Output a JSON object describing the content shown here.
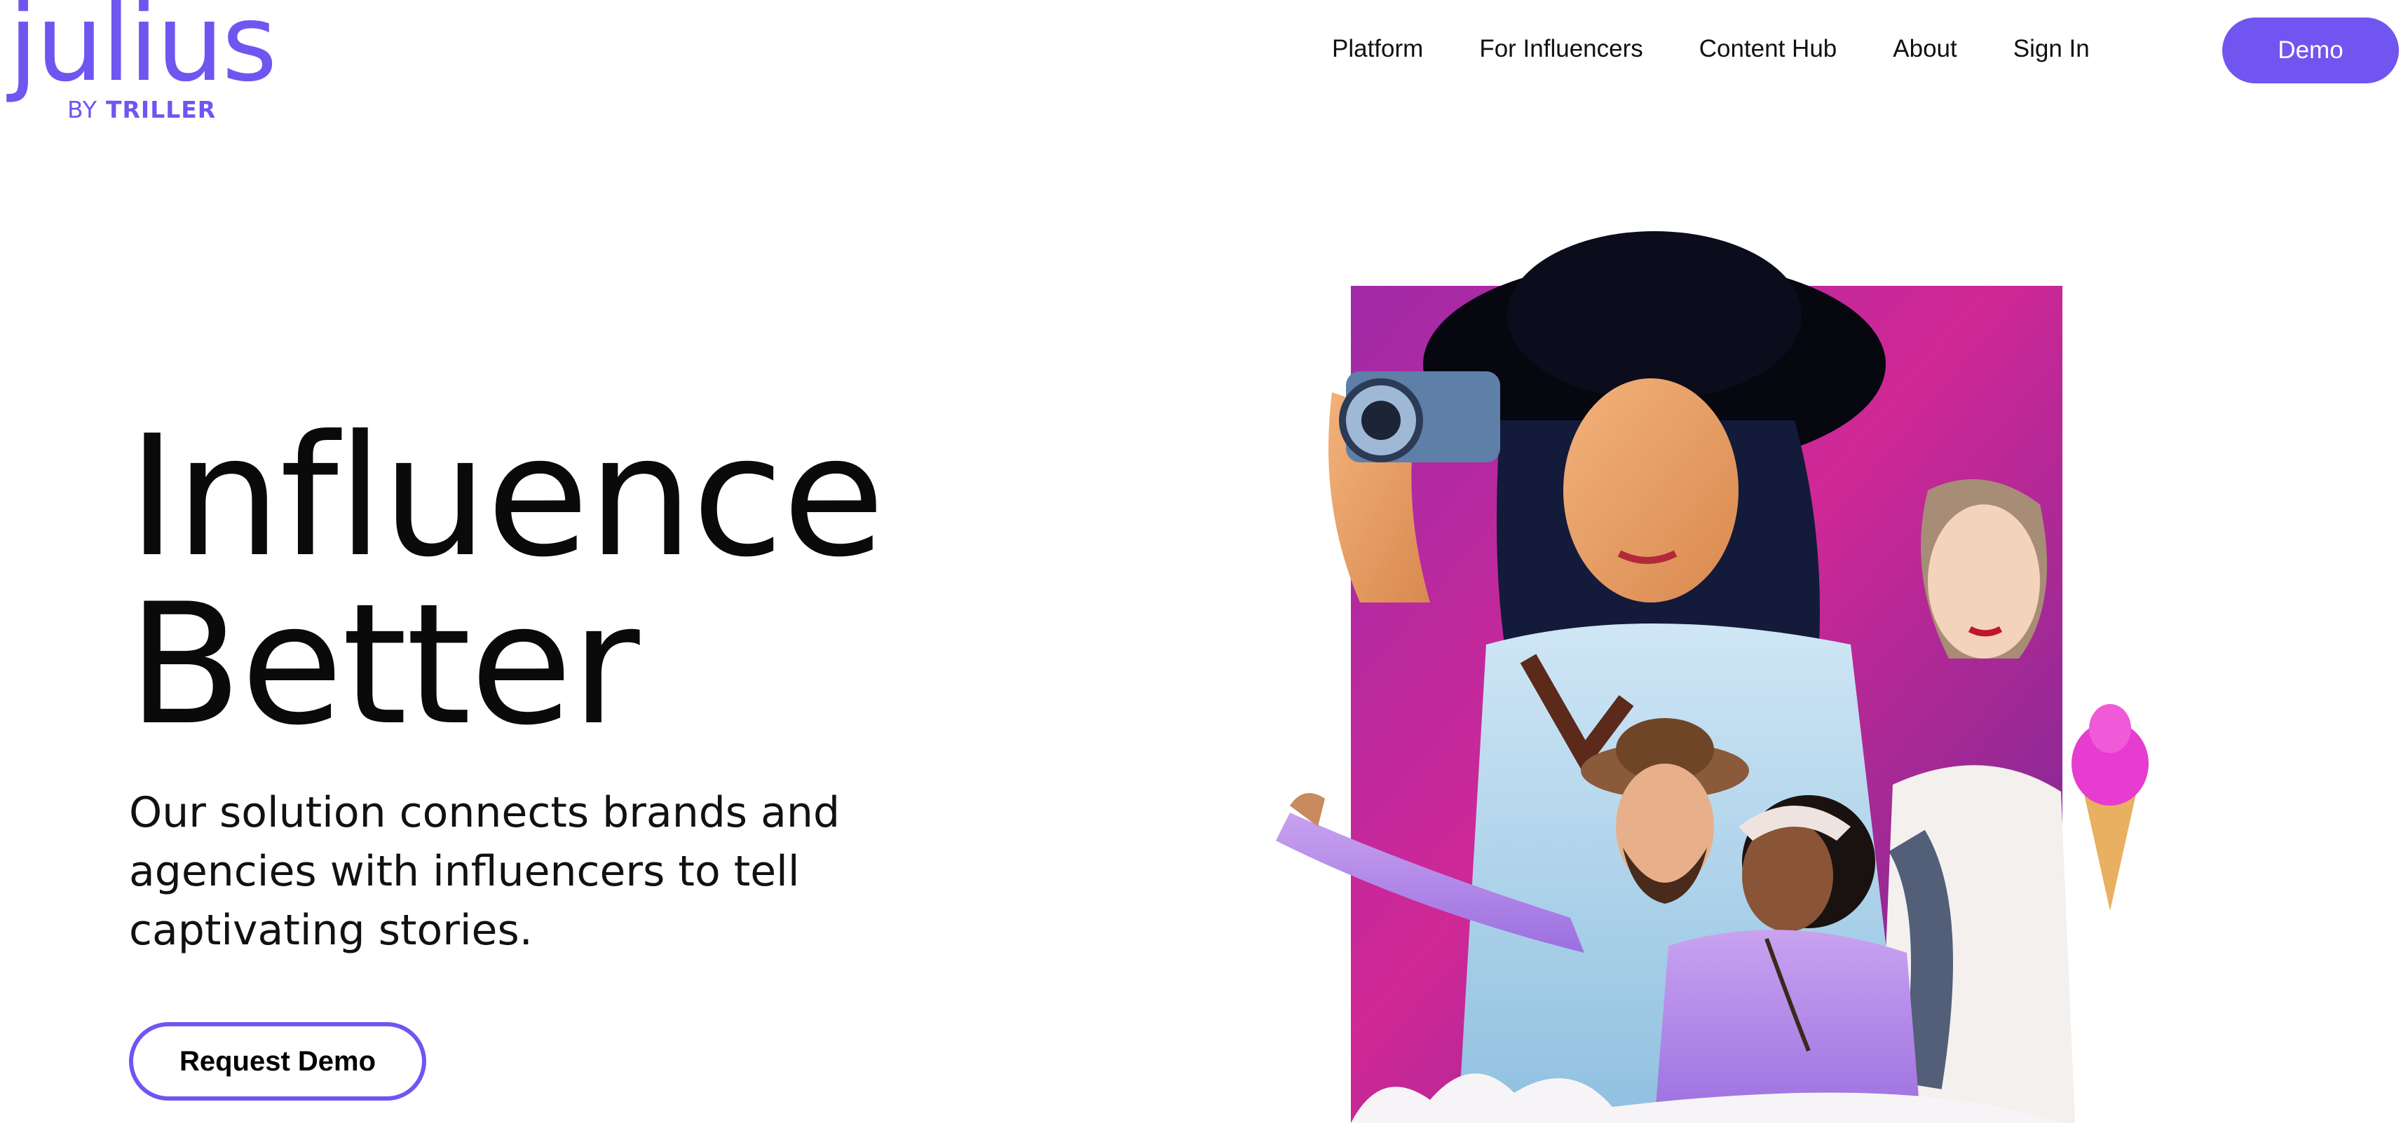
{
  "logo": {
    "wordmark": "julius",
    "by": "BY",
    "brand": "TRILLER"
  },
  "nav": {
    "items": [
      {
        "label": "Platform"
      },
      {
        "label": "For Influencers"
      },
      {
        "label": "Content Hub"
      },
      {
        "label": "About"
      },
      {
        "label": "Sign In"
      }
    ],
    "demo_label": "Demo"
  },
  "hero": {
    "title_line1": "Influence",
    "title_line2": "Better",
    "subtitle": "Our solution connects brands and agencies with influencers to tell captivating stories.",
    "cta_label": "Request Demo",
    "image_icon": "influencer-collage-image"
  },
  "colors": {
    "accent": "#7155f0",
    "text": "#0a0a0a",
    "background": "#ffffff",
    "art_gradient_top": "#e0258f",
    "art_gradient_bottom": "#7a2a9e"
  }
}
